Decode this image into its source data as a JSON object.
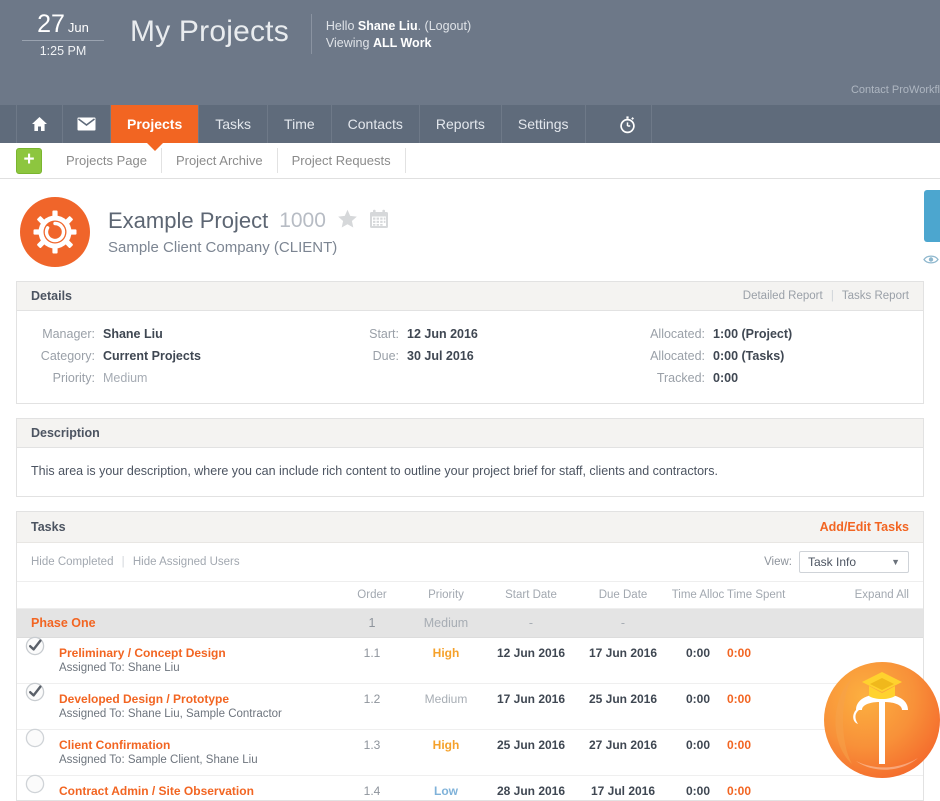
{
  "header": {
    "date_day": "27",
    "date_month": "Jun",
    "time": "1:25 PM",
    "app_title": "My Projects",
    "hello_prefix": "Hello ",
    "user_name": "Shane Liu",
    "logout": ". (Logout)",
    "viewing_prefix": "Viewing ",
    "viewing_scope": "ALL Work",
    "contact_link": "Contact ProWorkfl"
  },
  "nav": {
    "items": [
      {
        "label": "",
        "icon": "home-icon",
        "active": false
      },
      {
        "label": "",
        "icon": "mail-icon",
        "active": false
      },
      {
        "label": "Projects",
        "icon": "",
        "active": true
      },
      {
        "label": "Tasks",
        "icon": "",
        "active": false
      },
      {
        "label": "Time",
        "icon": "",
        "active": false
      },
      {
        "label": "Contacts",
        "icon": "",
        "active": false
      },
      {
        "label": "Reports",
        "icon": "",
        "active": false
      },
      {
        "label": "Settings",
        "icon": "",
        "active": false
      }
    ],
    "timer_icon": "stopwatch-icon"
  },
  "subtabs": {
    "add_label": "+",
    "items": [
      "Projects Page",
      "Project Archive",
      "Project Requests"
    ]
  },
  "project": {
    "name": "Example Project",
    "number": "1000",
    "client": "Sample Client Company (CLIENT)",
    "star_icon": "star-icon",
    "calendar_icon": "calendar-icon"
  },
  "details": {
    "title": "Details",
    "link_detailed": "Detailed Report",
    "link_tasks": "Tasks Report",
    "col1": [
      {
        "label": "Manager:",
        "value": "Shane Liu",
        "muted": false
      },
      {
        "label": "Category:",
        "value": "Current Projects",
        "muted": false
      },
      {
        "label": "Priority:",
        "value": "Medium",
        "muted": true
      }
    ],
    "col2": [
      {
        "label": "Start:",
        "value": "12 Jun 2016",
        "muted": false
      },
      {
        "label": "Due:",
        "value": "30 Jul 2016",
        "muted": false
      }
    ],
    "col3": [
      {
        "label": "Allocated:",
        "value": "1:00 (Project)",
        "muted": false
      },
      {
        "label": "Allocated:",
        "value": "0:00 (Tasks)",
        "muted": false
      },
      {
        "label": "Tracked:",
        "value": "0:00",
        "muted": false
      }
    ]
  },
  "description": {
    "title": "Description",
    "text": "This area is your description, where you can include rich content to outline your project brief for staff, clients and contractors."
  },
  "tasks": {
    "title": "Tasks",
    "add_edit": "Add/Edit Tasks",
    "hide_completed": "Hide Completed",
    "hide_assigned": "Hide Assigned Users",
    "view_label": "View:",
    "view_value": "Task Info",
    "columns": {
      "name": "",
      "order": "Order",
      "priority": "Priority",
      "start_date": "Start Date",
      "due_date": "Due Date",
      "time_alloc": "Time Alloc",
      "time_spent": "Time Spent",
      "expand": "Expand All"
    },
    "phase": {
      "name": "Phase One",
      "order": "1",
      "priority": "Medium",
      "start_date": "-",
      "due_date": "-"
    },
    "rows": [
      {
        "state": "checked",
        "name": "Preliminary / Concept Design",
        "order": "1.1",
        "priority": "High",
        "priority_class": "high",
        "start_date": "12 Jun 2016",
        "due_date": "17 Jun 2016",
        "time_alloc": "0:00",
        "time_spent": "0:00",
        "assigned": "Assigned To: Shane Liu"
      },
      {
        "state": "checked",
        "name": "Developed Design / Prototype",
        "order": "1.2",
        "priority": "Medium",
        "priority_class": "medium",
        "start_date": "17 Jun 2016",
        "due_date": "25 Jun 2016",
        "time_alloc": "0:00",
        "time_spent": "0:00",
        "assigned": "Assigned To: Shane Liu, Sample Contractor"
      },
      {
        "state": "unchecked",
        "name": "Client Confirmation",
        "order": "1.3",
        "priority": "High",
        "priority_class": "high",
        "start_date": "25 Jun 2016",
        "due_date": "27 Jun 2016",
        "time_alloc": "0:00",
        "time_spent": "0:00",
        "assigned": "Assigned To: Sample Client, Shane Liu"
      },
      {
        "state": "unchecked",
        "name": "Contract Admin / Site Observation",
        "order": "1.4",
        "priority": "Low",
        "priority_class": "low",
        "start_date": "28 Jun 2016",
        "due_date": "17 Jul 2016",
        "time_alloc": "0:00",
        "time_spent": "0:00",
        "assigned": ""
      }
    ]
  },
  "rail": {
    "toggle_icon": "rail-toggle",
    "eye_icon": "eye-icon"
  },
  "watermark": {
    "letter": "T",
    "cap_icon": "graduation-cap-icon"
  },
  "colors": {
    "header_bg": "#6d7888",
    "nav_bg": "#5f6b7b",
    "accent_orange": "#f26522",
    "accent_green": "#8dc63f",
    "rail_blue": "#4ca6cf"
  }
}
